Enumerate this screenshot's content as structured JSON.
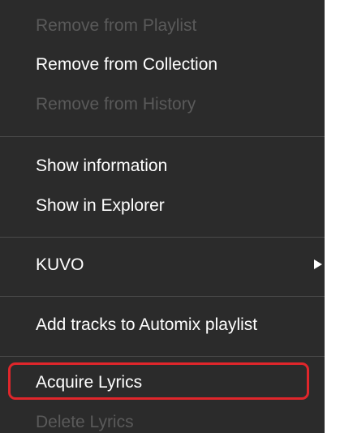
{
  "menu": {
    "items": [
      {
        "label": "Remove from Playlist",
        "enabled": false
      },
      {
        "label": "Remove from Collection",
        "enabled": true
      },
      {
        "label": "Remove from History",
        "enabled": false
      },
      {
        "label": "Show information",
        "enabled": true
      },
      {
        "label": "Show in Explorer",
        "enabled": true
      },
      {
        "label": "KUVO",
        "enabled": true,
        "has_submenu": true
      },
      {
        "label": "Add tracks to Automix playlist",
        "enabled": true
      },
      {
        "label": "Acquire Lyrics",
        "enabled": true,
        "highlighted": true
      },
      {
        "label": "Delete Lyrics",
        "enabled": false
      }
    ]
  },
  "colors": {
    "menu_background": "#2b2b2b",
    "enabled_text": "#ffffff",
    "disabled_text": "#5a5a5a",
    "divider": "#4a4a4a",
    "highlight_outline": "#e0262b"
  },
  "icons": {
    "submenu": "chevron-right-icon"
  }
}
